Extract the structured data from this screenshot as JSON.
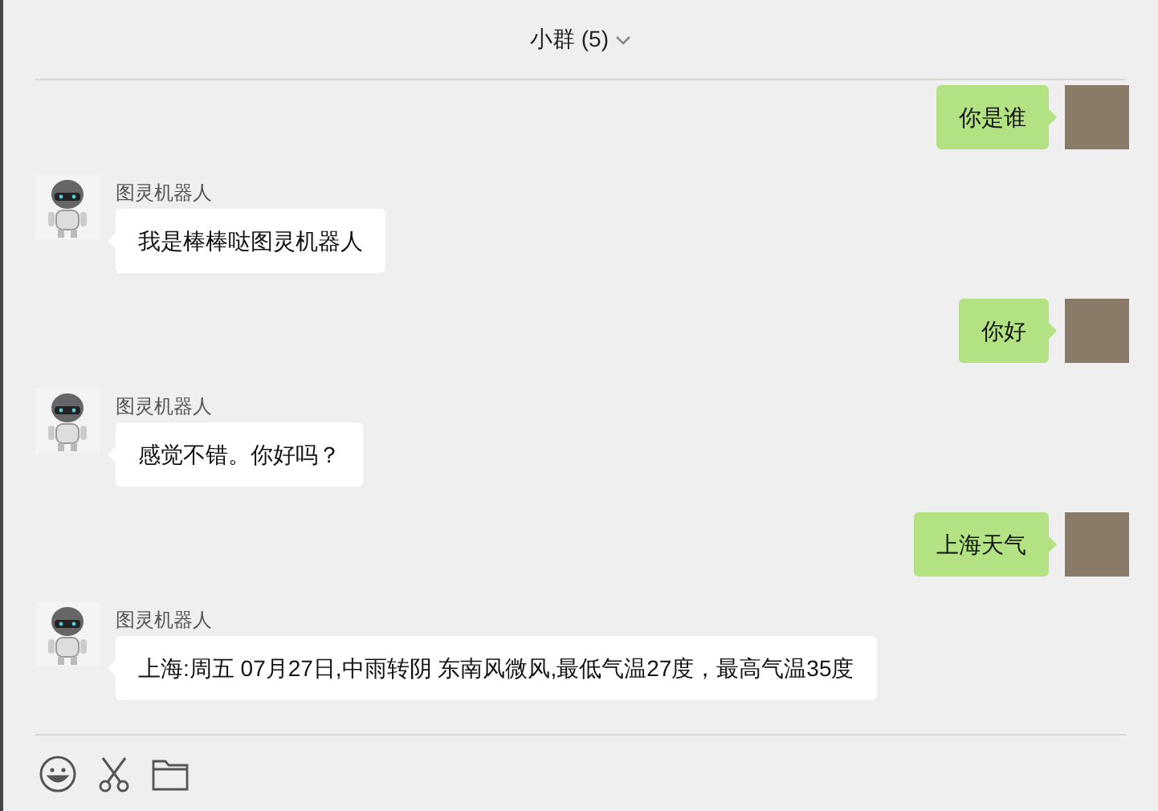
{
  "header": {
    "title": "小群 (5)"
  },
  "messages": [
    {
      "kind": "sent",
      "text": "你是谁"
    },
    {
      "kind": "received",
      "sender": "图灵机器人",
      "text": "我是棒棒哒图灵机器人"
    },
    {
      "kind": "sent",
      "text": "你好"
    },
    {
      "kind": "received",
      "sender": "图灵机器人",
      "text": "感觉不错。你好吗？"
    },
    {
      "kind": "sent",
      "text": "上海天气"
    },
    {
      "kind": "received",
      "sender": "图灵机器人",
      "text": "上海:周五 07月27日,中雨转阴 东南风微风,最低气温27度，最高气温35度"
    }
  ]
}
